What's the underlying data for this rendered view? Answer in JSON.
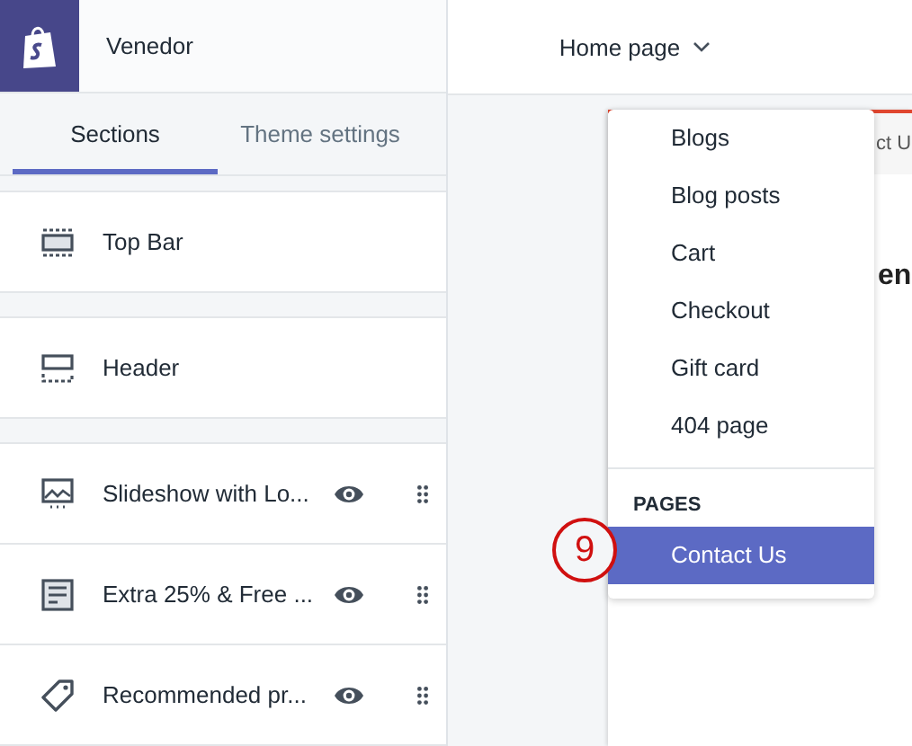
{
  "store": {
    "name": "Venedor"
  },
  "tabs": [
    {
      "label": "Sections",
      "selected": true
    },
    {
      "label": "Theme settings",
      "selected": false
    }
  ],
  "section_groups": [
    [
      {
        "kind": "top-bar",
        "label": "Top Bar",
        "movable": false
      }
    ],
    [
      {
        "kind": "header",
        "label": "Header",
        "movable": false
      }
    ],
    [
      {
        "kind": "slideshow",
        "label": "Slideshow with Lo...",
        "movable": true
      },
      {
        "kind": "text",
        "label": "Extra 25% & Free ...",
        "movable": true
      },
      {
        "kind": "tag",
        "label": "Recommended pr...",
        "movable": true
      }
    ]
  ],
  "page_selector": {
    "label": "Home page"
  },
  "preview": {
    "nav_text": "ct U",
    "title": "en"
  },
  "dropdown": {
    "groups": [
      {
        "items": [
          {
            "label": "Blogs",
            "selected": false
          },
          {
            "label": "Blog posts",
            "selected": false
          },
          {
            "label": "Cart",
            "selected": false
          },
          {
            "label": "Checkout",
            "selected": false
          },
          {
            "label": "Gift card",
            "selected": false
          },
          {
            "label": "404 page",
            "selected": false
          }
        ]
      },
      {
        "heading": "PAGES",
        "items": [
          {
            "label": "Contact Us",
            "selected": true
          }
        ]
      }
    ]
  },
  "annotation": {
    "label": "9"
  }
}
